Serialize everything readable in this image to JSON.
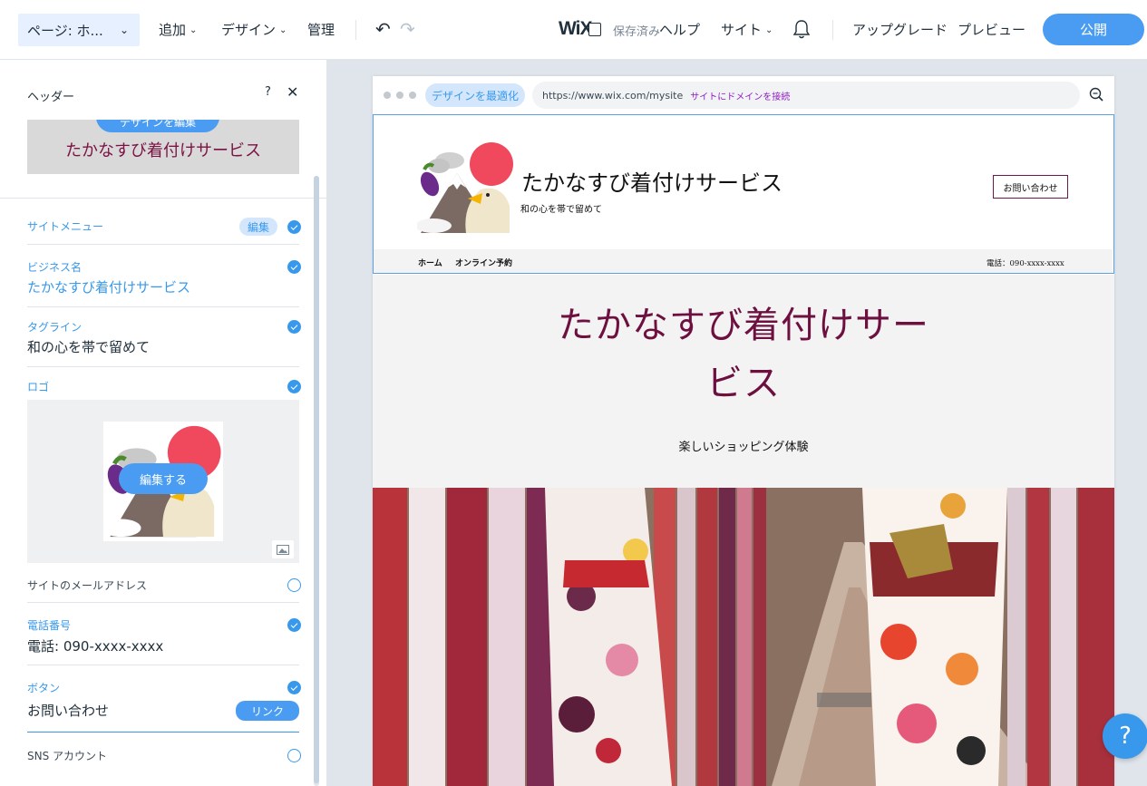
{
  "topbar": {
    "page_selector": "ページ: ホ...",
    "menus": [
      "追加",
      "デザイン",
      "管理"
    ],
    "logo": "WiX",
    "saved_status": "保存済み",
    "help": "ヘルプ",
    "site": "サイト",
    "upgrade": "アップグレード",
    "preview": "プレビュー",
    "publish": "公開"
  },
  "panel": {
    "title": "ヘッダー",
    "help": "?",
    "design_preview_button": "デザインを編集",
    "design_preview_text": "たかなすび着付けサービス",
    "rows": {
      "site_menu": {
        "label": "サイトメニュー",
        "pill": "編集"
      },
      "business_name": {
        "label": "ビジネス名",
        "value": "たかなすび着付けサービス"
      },
      "tagline": {
        "label": "タグライン",
        "value": "和の心を帯で留めて"
      },
      "logo": {
        "label": "ロゴ",
        "edit_button": "編集する"
      },
      "site_email": {
        "label": "サイトのメールアドレス"
      },
      "phone": {
        "label": "電話番号",
        "value": "電話: 090-xxxx-xxxx"
      },
      "button": {
        "label": "ボタン",
        "value": "お問い合わせ",
        "pill": "リンク"
      },
      "sns": {
        "label": "SNS アカウント"
      }
    }
  },
  "browser": {
    "optimize": "デザインを最適化",
    "url": "https://www.wix.com/mysite",
    "connect_domain": "サイトにドメインを接続"
  },
  "site": {
    "name": "たかなすび着付けサービス",
    "tagline": "和の心を帯で留めて",
    "contact_button": "お問い合わせ",
    "nav": [
      "ホーム",
      "オンライン予約"
    ],
    "phone": "電話：090-xxxx-xxxx",
    "hero_title_1": "たかなすび着付けサー",
    "hero_title_2": "ビス",
    "hero_subtitle": "楽しいショッピング体験"
  },
  "fab_help": "?",
  "colors": {
    "accent": "#3899ec",
    "publish": "#4a9cf2",
    "hero_title": "#6d1040",
    "canvas_bg": "#dfe5eb"
  }
}
